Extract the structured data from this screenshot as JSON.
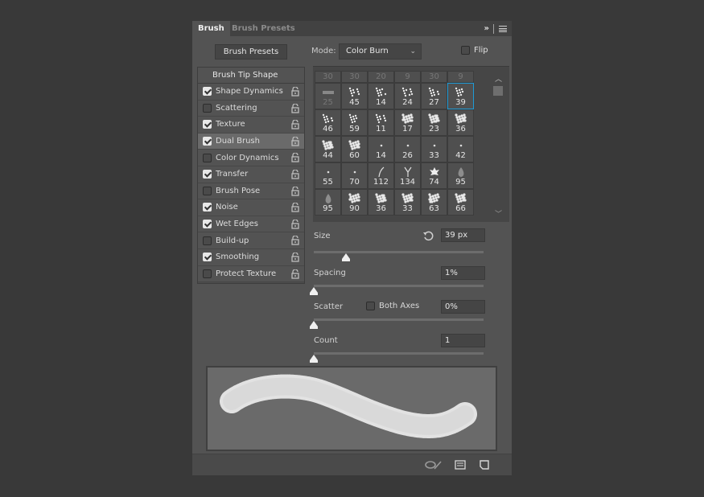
{
  "tabs": [
    {
      "label": "Brush",
      "active": true
    },
    {
      "label": "Brush Presets",
      "active": false
    }
  ],
  "panel_menu_icons": [
    "expand-icon",
    "menu-icon"
  ],
  "toolbar": {
    "brush_presets_button": "Brush Presets",
    "mode_label": "Mode:",
    "mode_value": "Color Burn",
    "flip_label": "Flip",
    "flip_checked": false
  },
  "settings": {
    "header": "Brush Tip Shape",
    "items": [
      {
        "label": "Shape Dynamics",
        "checked": true
      },
      {
        "label": "Scattering",
        "checked": false
      },
      {
        "label": "Texture",
        "checked": true
      },
      {
        "label": "Dual Brush",
        "checked": true,
        "selected": true
      },
      {
        "label": "Color Dynamics",
        "checked": false
      },
      {
        "label": "Transfer",
        "checked": true
      },
      {
        "label": "Brush Pose",
        "checked": false
      },
      {
        "label": "Noise",
        "checked": true
      },
      {
        "label": "Wet Edges",
        "checked": true
      },
      {
        "label": "Build-up",
        "checked": false
      },
      {
        "label": "Smoothing",
        "checked": true
      },
      {
        "label": "Protect Texture",
        "checked": false
      }
    ]
  },
  "tip_grid": {
    "header_row": [
      "30",
      "30",
      "20",
      "9",
      "30",
      "9"
    ],
    "rows": [
      [
        "25",
        "45",
        "14",
        "24",
        "27",
        "39"
      ],
      [
        "46",
        "59",
        "11",
        "17",
        "23",
        "36"
      ],
      [
        "44",
        "60",
        "14",
        "26",
        "33",
        "42"
      ],
      [
        "55",
        "70",
        "112",
        "134",
        "74",
        "95"
      ],
      [
        "95",
        "90",
        "36",
        "33",
        "63",
        "66"
      ]
    ],
    "selected": "39",
    "selection_color": "#1e9bd7"
  },
  "controls": {
    "size": {
      "label": "Size",
      "value": "39 px",
      "fraction": 0.19
    },
    "spacing": {
      "label": "Spacing",
      "value": "1%",
      "fraction": 0.0
    },
    "scatter": {
      "label": "Scatter",
      "both_axes_label": "Both Axes",
      "both_axes_checked": false,
      "value": "0%",
      "fraction": 0.0
    },
    "count": {
      "label": "Count",
      "value": "1",
      "fraction": 0.0
    }
  },
  "footer_icons": [
    "toggle-live-tip-preview-icon",
    "brush-tip-editor-icon",
    "create-new-brush-icon"
  ]
}
